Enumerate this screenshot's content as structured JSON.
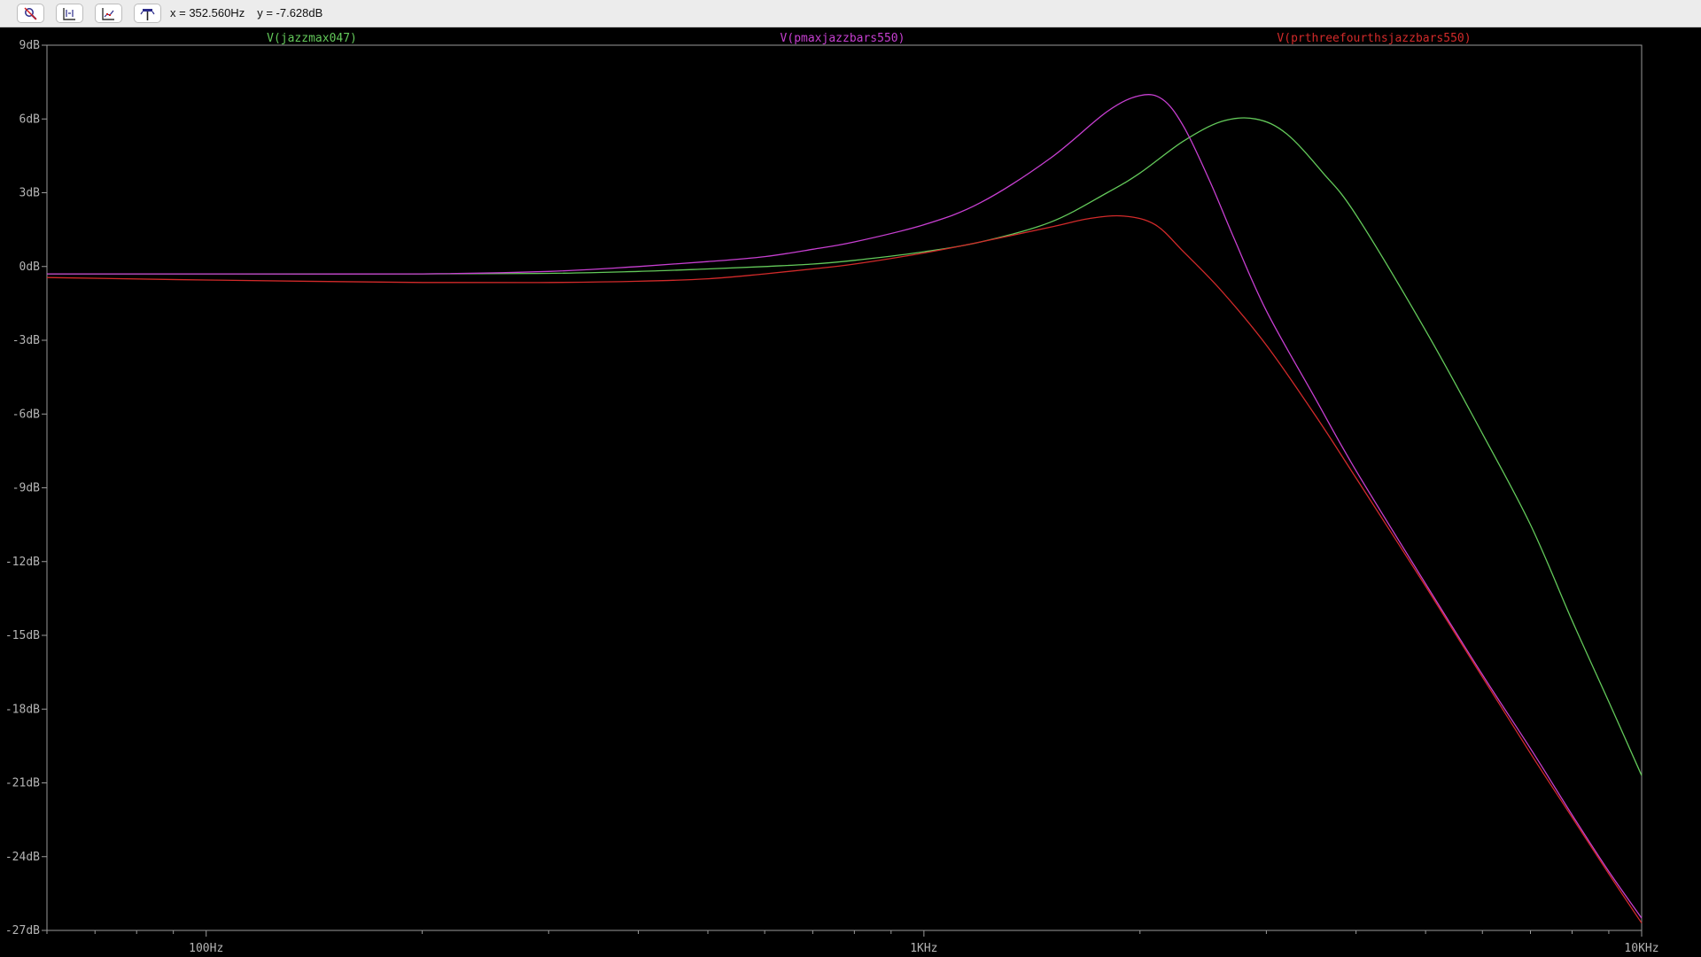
{
  "toolbar": {
    "buttons": [
      {
        "name": "zoom-cancel-button",
        "icon": "zoom-cancel-icon"
      },
      {
        "name": "autorange-button",
        "icon": "autorange-icon"
      },
      {
        "name": "mark-data-points-button",
        "icon": "mark-points-icon"
      },
      {
        "name": "probe-button",
        "icon": "probe-icon"
      }
    ],
    "cursor_x": "x = 352.560Hz",
    "cursor_y": "y = -7.628dB"
  },
  "colors": {
    "background": "#000000",
    "axis": "#9a9a9a",
    "grid_label": "#b4b4b4",
    "green": "#63c95a",
    "magenta": "#c73fd1",
    "red": "#d22a2a"
  },
  "chart_data": {
    "type": "line",
    "title": "",
    "xlabel": "",
    "ylabel": "",
    "x_scale": "log",
    "xlim": [
      60,
      10000
    ],
    "ylim": [
      -27,
      9
    ],
    "grid": false,
    "y_ticks": [
      {
        "value": 9,
        "label": "9dB"
      },
      {
        "value": 6,
        "label": "6dB"
      },
      {
        "value": 3,
        "label": "3dB"
      },
      {
        "value": 0,
        "label": "0dB"
      },
      {
        "value": -3,
        "label": "-3dB"
      },
      {
        "value": -6,
        "label": "-6dB"
      },
      {
        "value": -9,
        "label": "-9dB"
      },
      {
        "value": -12,
        "label": "-12dB"
      },
      {
        "value": -15,
        "label": "-15dB"
      },
      {
        "value": -18,
        "label": "-18dB"
      },
      {
        "value": -21,
        "label": "-21dB"
      },
      {
        "value": -24,
        "label": "-24dB"
      },
      {
        "value": -27,
        "label": "-27dB"
      }
    ],
    "x_ticks": [
      {
        "value": 100,
        "label": "100Hz"
      },
      {
        "value": 1000,
        "label": "1KHz"
      },
      {
        "value": 10000,
        "label": "10KHz"
      }
    ],
    "x_minor_ticks": [
      60,
      70,
      80,
      90,
      200,
      300,
      400,
      500,
      600,
      700,
      800,
      900,
      2000,
      3000,
      4000,
      5000,
      6000,
      7000,
      8000,
      9000
    ],
    "series": [
      {
        "name": "V(jazzmax047)",
        "color": "#63c95a",
        "x": [
          60,
          100,
          200,
          300,
          400,
          500,
          600,
          700,
          800,
          1000,
          1200,
          1500,
          1800,
          2000,
          2300,
          2600,
          2900,
          3200,
          3600,
          4000,
          5000,
          6000,
          7000,
          8000,
          9000,
          10000
        ],
        "y": [
          -0.3,
          -0.3,
          -0.3,
          -0.28,
          -0.2,
          -0.1,
          0.0,
          0.1,
          0.25,
          0.6,
          1.0,
          1.8,
          3.0,
          3.8,
          5.1,
          5.9,
          6.0,
          5.4,
          3.8,
          2.1,
          -2.6,
          -6.8,
          -10.5,
          -14.4,
          -17.7,
          -20.7
        ]
      },
      {
        "name": "V(pmaxjazzbars550)",
        "color": "#c73fd1",
        "x": [
          60,
          100,
          200,
          300,
          400,
          500,
          600,
          700,
          800,
          1000,
          1200,
          1500,
          1800,
          2000,
          2150,
          2300,
          2500,
          2700,
          3000,
          3500,
          4000,
          5000,
          6000,
          7000,
          8000,
          9000,
          10000
        ],
        "y": [
          -0.3,
          -0.3,
          -0.3,
          -0.2,
          0.0,
          0.2,
          0.4,
          0.7,
          1.0,
          1.7,
          2.6,
          4.4,
          6.3,
          6.95,
          6.8,
          5.7,
          3.5,
          1.2,
          -1.8,
          -5.3,
          -8.3,
          -12.9,
          -16.6,
          -19.6,
          -22.3,
          -24.6,
          -26.5
        ]
      },
      {
        "name": "V(prthreefourthsjazzbars550)",
        "color": "#d22a2a",
        "x": [
          60,
          100,
          200,
          300,
          400,
          500,
          600,
          700,
          800,
          1000,
          1200,
          1500,
          1700,
          1900,
          2100,
          2300,
          2600,
          3000,
          3500,
          4000,
          5000,
          6000,
          7000,
          8000,
          9000,
          10000
        ],
        "y": [
          -0.45,
          -0.55,
          -0.65,
          -0.65,
          -0.6,
          -0.5,
          -0.3,
          -0.1,
          0.1,
          0.55,
          1.0,
          1.6,
          1.95,
          2.05,
          1.7,
          0.6,
          -1.0,
          -3.2,
          -6.0,
          -8.6,
          -13.0,
          -16.7,
          -19.8,
          -22.4,
          -24.7,
          -26.7
        ]
      }
    ]
  }
}
